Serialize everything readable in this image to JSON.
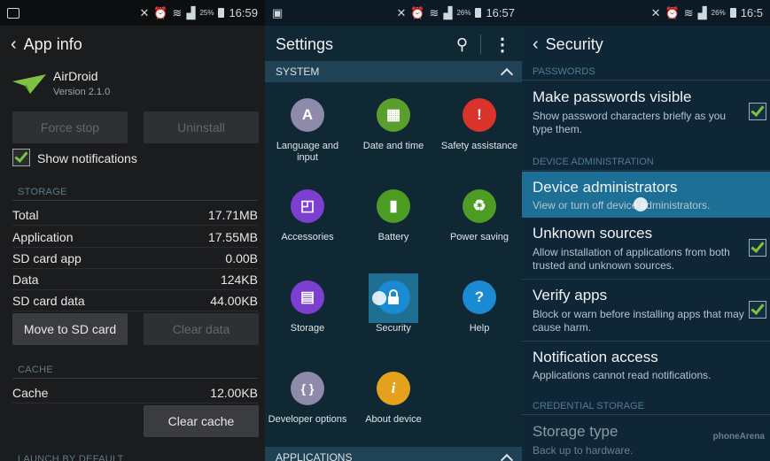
{
  "status": {
    "panel1": {
      "battery": "25%",
      "time": "16:59"
    },
    "panel2": {
      "battery": "26%",
      "time": "16:57"
    },
    "panel3": {
      "battery": "26%",
      "time": "16:5"
    }
  },
  "app_info": {
    "title": "App info",
    "app_name": "AirDroid",
    "version": "Version 2.1.0",
    "force_stop": "Force stop",
    "uninstall": "Uninstall",
    "show_notifications": "Show notifications",
    "storage_header": "STORAGE",
    "storage": [
      {
        "label": "Total",
        "value": "17.71MB"
      },
      {
        "label": "Application",
        "value": "17.55MB"
      },
      {
        "label": "SD card app",
        "value": "0.00B"
      },
      {
        "label": "Data",
        "value": "124KB"
      },
      {
        "label": "SD card data",
        "value": "44.00KB"
      }
    ],
    "move_sd": "Move to SD card",
    "clear_data": "Clear data",
    "cache_header": "CACHE",
    "cache_label": "Cache",
    "cache_value": "12.00KB",
    "clear_cache": "Clear cache",
    "launch_header": "LAUNCH BY DEFAULT"
  },
  "settings": {
    "title": "Settings",
    "system_header": "SYSTEM",
    "apps_header": "APPLICATIONS",
    "tiles": [
      {
        "label": "Language and input",
        "icon": "A",
        "color": "#8e8aa9"
      },
      {
        "label": "Date and time",
        "icon": "▦",
        "color": "#5a9e2e"
      },
      {
        "label": "Safety assistance",
        "icon": "!",
        "color": "#d9332b"
      },
      {
        "label": "Accessories",
        "icon": "◰",
        "color": "#7d3fcf"
      },
      {
        "label": "Battery",
        "icon": "▮",
        "color": "#4d9d24"
      },
      {
        "label": "Power saving",
        "icon": "♻",
        "color": "#4d9d24"
      },
      {
        "label": "Storage",
        "icon": "▤",
        "color": "#7d3fcf"
      },
      {
        "label": "Security",
        "icon": "🔒",
        "color": "#1a8bd2"
      },
      {
        "label": "Help",
        "icon": "?",
        "color": "#1a8bd2"
      },
      {
        "label": "Developer options",
        "icon": "{ }",
        "color": "#8e8aa9"
      },
      {
        "label": "About device",
        "icon": "i",
        "color": "#e4a11b"
      }
    ]
  },
  "security": {
    "title": "Security",
    "passwords_header": "PASSWORDS",
    "device_admin_header": "DEVICE ADMINISTRATION",
    "credential_header": "CREDENTIAL STORAGE",
    "rows": [
      {
        "title": "Make passwords visible",
        "desc": "Show password characters briefly as you type them."
      },
      {
        "title": "Device administrators",
        "desc": "View or turn off device administrators."
      },
      {
        "title": "Unknown sources",
        "desc": "Allow installation of applications from both trusted and unknown sources."
      },
      {
        "title": "Verify apps",
        "desc": "Block or warn before installing apps that may cause harm."
      },
      {
        "title": "Notification access",
        "desc": "Applications cannot read notifications."
      },
      {
        "title": "Storage type",
        "desc": "Back up to hardware."
      }
    ]
  },
  "watermark": "phoneArena"
}
